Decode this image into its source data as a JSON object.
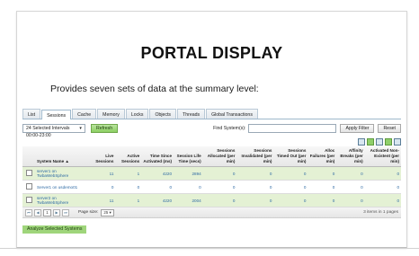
{
  "slide": {
    "title": "PORTAL DISPLAY",
    "subtitle": "Provides seven sets of data at the summary level:"
  },
  "tabs": [
    {
      "label": "List",
      "active": false
    },
    {
      "label": "Sessions",
      "active": true
    },
    {
      "label": "Cache",
      "active": false
    },
    {
      "label": "Memory",
      "active": false
    },
    {
      "label": "Locks",
      "active": false
    },
    {
      "label": "Objects",
      "active": false
    },
    {
      "label": "Threads",
      "active": false
    },
    {
      "label": "Global Transactions",
      "active": false
    }
  ],
  "toolbar": {
    "interval_value": "24 Selected Intervals 00:00-23:00",
    "refresh_label": "Refresh",
    "find_label": "Find System(s):",
    "apply_filter_label": "Apply Filter",
    "reset_label": "Reset"
  },
  "table": {
    "headers": [
      "System Name ▲",
      "Live Sessions",
      "Active Sessions",
      "Time Since Activated (ms)",
      "Session Life Time (secs)",
      "Sessions Allocated (per min)",
      "Sessions Invalidated (per min)",
      "Sessions Timed Out (per min)",
      "Alloc Failures (per min)",
      "Affinity Breaks (per min)",
      "Activated Non-Existent (per min)"
    ],
    "rows": [
      {
        "name": "server1 on TwbaWebSphere",
        "cells": [
          "11",
          "1",
          "4220",
          "2894",
          "0",
          "0",
          "0",
          "0",
          "0",
          "0"
        ]
      },
      {
        "name": "Server1 on usdemo01",
        "cells": [
          "0",
          "0",
          "0",
          "0",
          "0",
          "0",
          "0",
          "0",
          "0",
          "0"
        ]
      },
      {
        "name": "server2 on TwbaWebSphere",
        "cells": [
          "11",
          "1",
          "4220",
          "2004",
          "0",
          "0",
          "0",
          "0",
          "0",
          "0"
        ]
      }
    ]
  },
  "pager": {
    "page": "1",
    "page_size_label": "Page size:",
    "page_size_value": "25",
    "info": "3 items in 1 pages"
  },
  "analyze_label": "Analyze Selected Systems"
}
